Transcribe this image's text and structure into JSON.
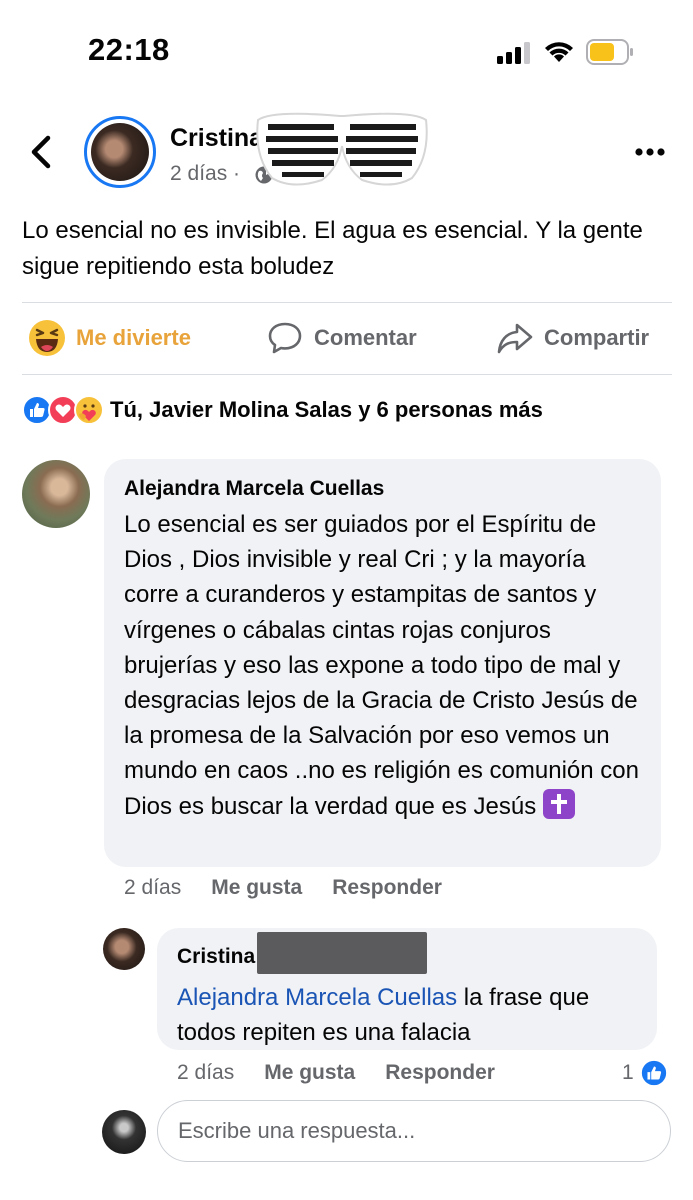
{
  "status_bar": {
    "time": "22:18"
  },
  "post": {
    "author": "Cristina",
    "time": "2 días ·",
    "text": "Lo esencial no es invisible.  El agua es esencial.  Y la gente sigue repitiendo esta boludez"
  },
  "actions": {
    "reaction": "Me divierte",
    "comment": "Comentar",
    "share": "Compartir"
  },
  "reactions_summary": "Tú, Javier Molina Salas y 6 personas más",
  "comments": [
    {
      "author": "Alejandra Marcela Cuellas",
      "text": "Lo esencial es ser guiados por el Espíritu de Dios , Dios invisible y real Cri ; y la mayoría corre a curanderos y estampitas de santos y vírgenes o cábalas cintas rojas conjuros brujerías y eso las expone a todo tipo de mal y desgracias lejos de la Gracia de Cristo Jesús de la promesa de la Salvación por eso vemos un mundo en caos ..no es religión es comunión con Dios es buscar la verdad que es  Jesús",
      "time": "2 días",
      "like_label": "Me gusta",
      "reply_label": "Responder"
    },
    {
      "author": "Cristina",
      "mention": "Alejandra Marcela Cuellas",
      "text": " la frase que todos repiten es una falacia",
      "time": "2 días",
      "like_label": "Me gusta",
      "reply_label": "Responder",
      "like_count": "1"
    }
  ],
  "reply": {
    "placeholder": "Escribe una respuesta..."
  },
  "colors": {
    "accent": "#1877f2",
    "haha": "#e8a33a",
    "mention": "#1a54b4",
    "bubble": "#f0f2f5"
  }
}
